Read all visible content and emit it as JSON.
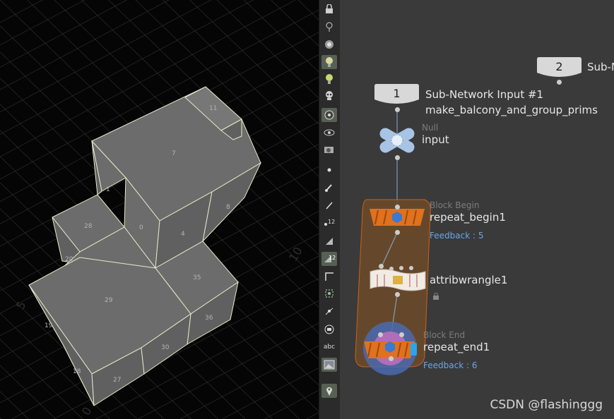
{
  "viewport": {
    "primitive_numbers": [
      "11",
      "7",
      "1",
      "28",
      "0",
      "4",
      "8",
      "20",
      "35",
      "29",
      "19",
      "36",
      "30",
      "18",
      "27"
    ],
    "grid_labels": [
      "10",
      "5",
      "0"
    ]
  },
  "toolbar": {
    "tools": [
      "lock-icon",
      "ghost-icon",
      "camera-icon",
      "light-icon",
      "light-add-icon",
      "skull-icon",
      "display-icon",
      "eye-icon",
      "snapshot-icon",
      "point-icon",
      "brush-icon",
      "pen-icon",
      "number-icon",
      "clear-icon",
      "number-display-icon",
      "corner-icon",
      "select-icon",
      "branch-icon",
      "frame-icon",
      "text-icon",
      "image-icon",
      "pin-icon"
    ],
    "abc_label": "abc",
    "num_label": "12"
  },
  "network": {
    "subnet_input_1": {
      "number": "1",
      "label": "Sub-Network Input #1",
      "sublabel": "make_balcony_and_group_prims"
    },
    "subnet_input_2": {
      "number": "2",
      "label": "Sub-N"
    },
    "null_node": {
      "type": "Null",
      "name": "input"
    },
    "repeat_begin": {
      "type": "Block Begin",
      "name": "repeat_begin1",
      "feedback": "Feedback : 5"
    },
    "attribwrangle": {
      "name": "attribwrangle1"
    },
    "repeat_end": {
      "type": "Block End",
      "name": "repeat_end1",
      "feedback": "Feedback : 6"
    }
  },
  "watermark": "CSDN @flashinggg",
  "colors": {
    "viewport_bg": "#050505",
    "network_bg": "#3a3a3a",
    "block_orange": "#d9661a",
    "feedback_blue": "#6aa6e8"
  }
}
